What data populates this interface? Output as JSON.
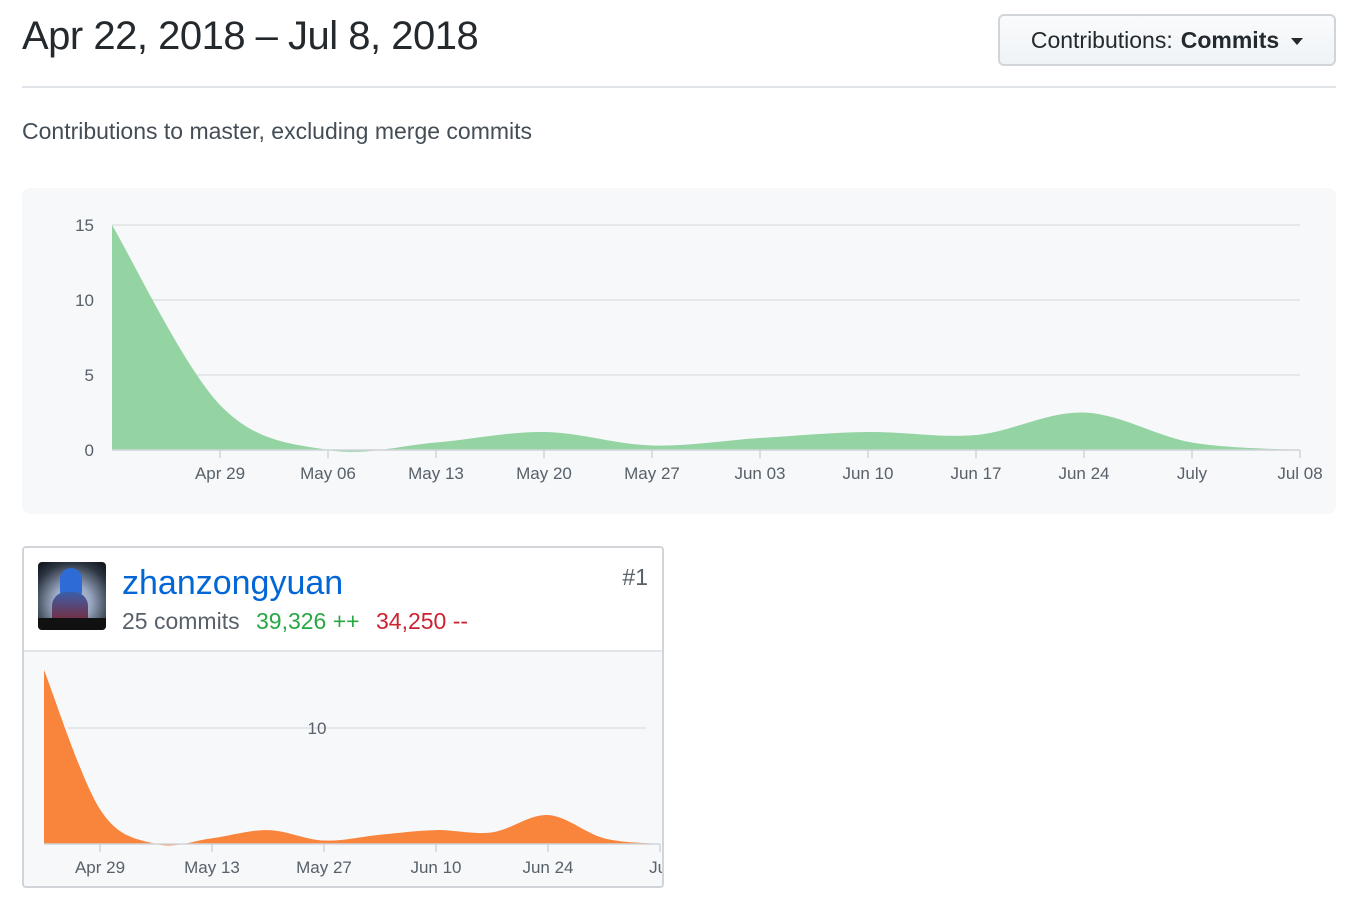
{
  "header": {
    "date_range": "Apr 22, 2018 – Jul 8, 2018",
    "contributions_prefix": "Contributions:",
    "contributions_value": "Commits"
  },
  "subtitle": "Contributions to master, excluding merge commits",
  "chart_data": [
    {
      "type": "area",
      "title": "",
      "xlabel": "",
      "ylabel": "",
      "color": "#94d3a2",
      "ylim": [
        0,
        15
      ],
      "yticks": [
        0,
        5,
        10,
        15
      ],
      "xticks": [
        "Apr 29",
        "May 06",
        "May 13",
        "May 20",
        "May 27",
        "Jun 03",
        "Jun 10",
        "Jun 17",
        "Jun 24",
        "July",
        "Jul 08"
      ],
      "x": [
        "2018-04-22",
        "2018-04-29",
        "2018-05-06",
        "2018-05-13",
        "2018-05-20",
        "2018-05-27",
        "2018-06-03",
        "2018-06-10",
        "2018-06-17",
        "2018-06-24",
        "2018-07-01",
        "2018-07-08"
      ],
      "values": [
        15,
        3,
        0,
        0.5,
        1.2,
        0.3,
        0.8,
        1.2,
        1,
        2.5,
        0.5,
        0
      ]
    },
    {
      "type": "area",
      "title": "",
      "xlabel": "",
      "ylabel": "",
      "color": "#f9843c",
      "ylim": [
        0,
        15
      ],
      "gridline": 10,
      "xticks": [
        "Apr 29",
        "May 13",
        "May 27",
        "Jun 10",
        "Jun 24",
        "Jul"
      ],
      "x": [
        "2018-04-22",
        "2018-04-29",
        "2018-05-06",
        "2018-05-13",
        "2018-05-20",
        "2018-05-27",
        "2018-06-03",
        "2018-06-10",
        "2018-06-17",
        "2018-06-24",
        "2018-07-01",
        "2018-07-08"
      ],
      "values": [
        15,
        3,
        0,
        0.5,
        1.2,
        0.3,
        0.8,
        1.2,
        1,
        2.5,
        0.5,
        0
      ]
    }
  ],
  "contributor": {
    "name": "zhanzongyuan",
    "rank": "#1",
    "commits": "25 commits",
    "additions": "39,326 ++",
    "deletions": "34,250 --"
  }
}
